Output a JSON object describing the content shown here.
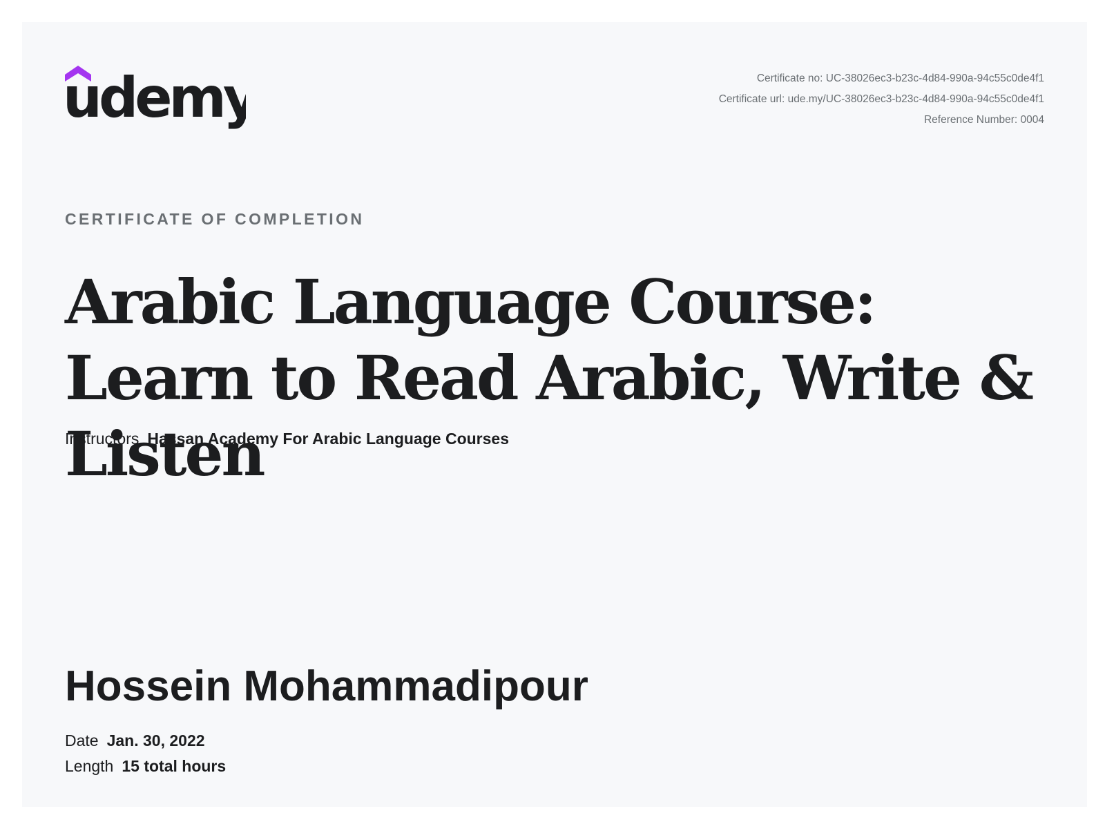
{
  "brand": {
    "name": "udemy",
    "accent_color": "#a435f0",
    "text_color": "#1c1d1f"
  },
  "certificate_meta": {
    "certificate_no": "Certificate no: UC-38026ec3-b23c-4d84-990a-94c55c0de4f1",
    "certificate_url": "Certificate url: ude.my/UC-38026ec3-b23c-4d84-990a-94c55c0de4f1",
    "reference_number": "Reference Number: 0004"
  },
  "heading": {
    "eyebrow": "CERTIFICATE OF COMPLETION",
    "course_title": "Arabic Language Course: Learn to Read Arabic, Write & Listen"
  },
  "instructors": {
    "label": "Instructors",
    "value": "Hassan Academy For Arabic Language Courses"
  },
  "recipient": {
    "name": "Hossein Mohammadipour"
  },
  "details": {
    "date_label": "Date",
    "date_value": "Jan. 30, 2022",
    "length_label": "Length",
    "length_value": "15 total hours"
  }
}
